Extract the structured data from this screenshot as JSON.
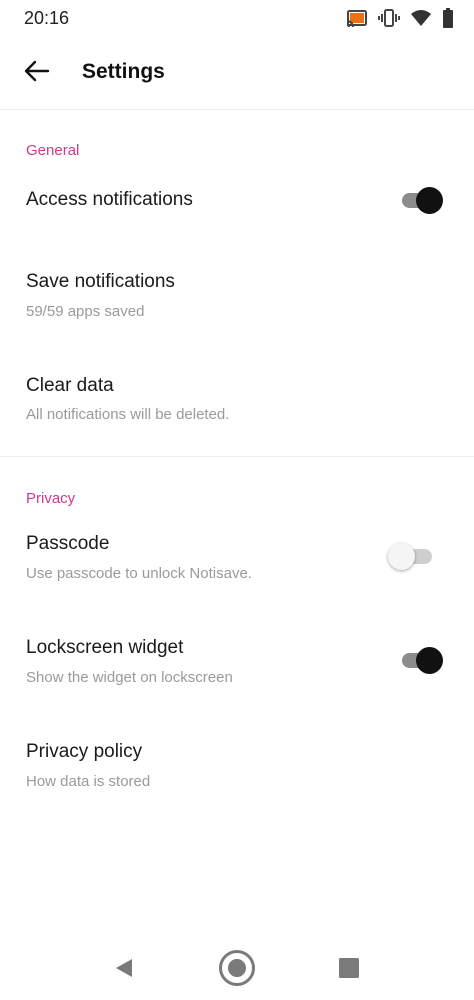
{
  "status_bar": {
    "time": "20:16",
    "icons": [
      "cast-icon",
      "vibrate-icon",
      "wifi-icon",
      "battery-icon"
    ]
  },
  "app_bar": {
    "back_icon": "arrow-back-icon",
    "title": "Settings"
  },
  "sections": {
    "general": {
      "header": "General",
      "access_notifications": {
        "title": "Access notifications",
        "enabled": true
      },
      "save_notifications": {
        "title": "Save notifications",
        "subtitle": "59/59 apps saved"
      },
      "clear_data": {
        "title": "Clear data",
        "subtitle": "All notifications will be deleted."
      }
    },
    "privacy": {
      "header": "Privacy",
      "passcode": {
        "title": "Passcode",
        "subtitle": "Use passcode to unlock Notisave.",
        "enabled": false
      },
      "lockscreen_widget": {
        "title": "Lockscreen widget",
        "subtitle": "Show the widget on lockscreen",
        "enabled": true
      },
      "privacy_policy": {
        "title": "Privacy policy",
        "subtitle": "How data is stored"
      }
    }
  },
  "nav_bar": {
    "icons": [
      "nav-back-icon",
      "nav-home-icon",
      "nav-recents-icon"
    ]
  },
  "colors": {
    "section_header": "#cc3b8a",
    "toggle_on_thumb": "#111111",
    "toggle_on_track": "#8c8c8c",
    "toggle_off_track": "#cfcfcf"
  }
}
